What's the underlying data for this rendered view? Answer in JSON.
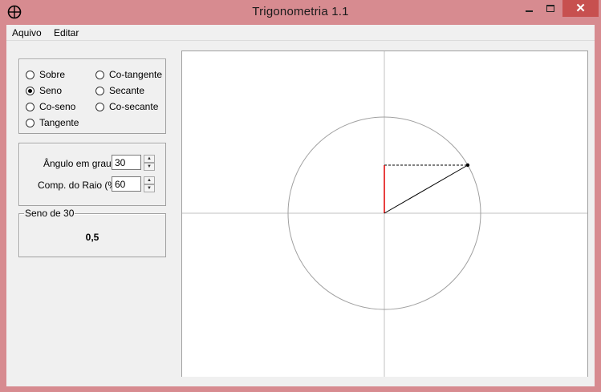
{
  "window": {
    "title": "Trigonometria 1.1",
    "close_glyph": "✕"
  },
  "menu": {
    "items": [
      "Aquivo",
      "Editar"
    ]
  },
  "functions": {
    "selected": "Seno",
    "options": [
      "Sobre",
      "Seno",
      "Co-seno",
      "Tangente",
      "Co-tangente",
      "Secante",
      "Co-secante"
    ]
  },
  "params": {
    "angle_label": "Ângulo em graus",
    "angle_value": "30",
    "radius_label": "Comp. do Raio (%)",
    "radius_value": "60"
  },
  "result": {
    "legend": "Seno de 30",
    "value": "0,5"
  },
  "plot": {
    "angle_degrees": 30,
    "radius_percent": 60,
    "axis_color": "#c0c0c0",
    "circle_color": "#a0a0a0",
    "sine_line_color": "#e00000"
  }
}
